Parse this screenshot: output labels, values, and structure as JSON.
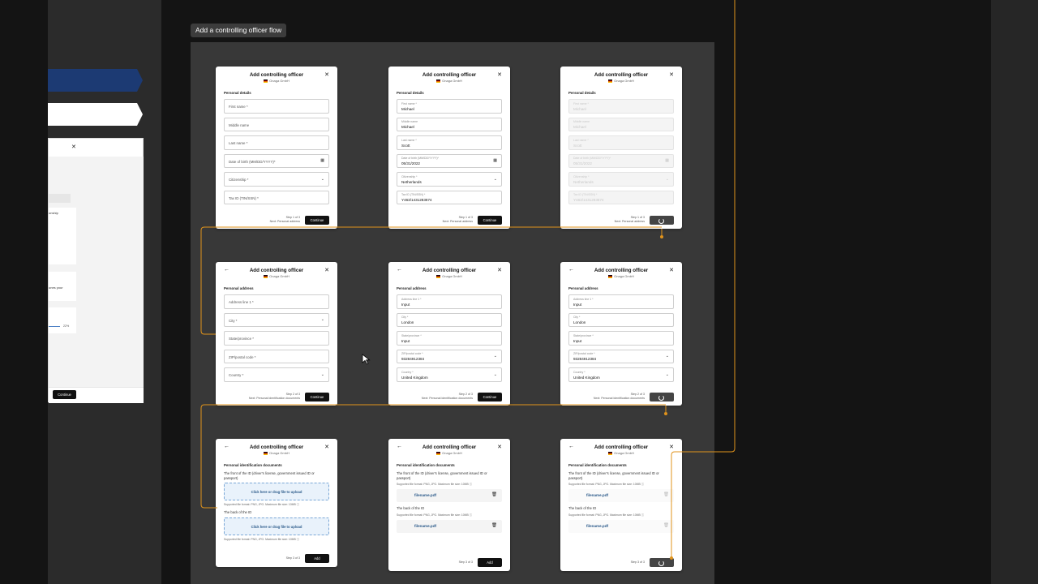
{
  "flow_title": "Add a controlling officer flow",
  "left_partial": {
    "continue_label": "Continue",
    "fragments": [
      "onship",
      "unes your",
      "22%"
    ]
  },
  "modals": {
    "title": "Add controlling officer",
    "company": "Onaga GmbH",
    "personal": {
      "section": "Personal details",
      "first_name": "First name *",
      "middle_name": "Middle name",
      "last_name": "Last name *",
      "dob": "Date of birth (MM/DD/YYYY)*",
      "citizenship": "Citizenship *",
      "tax_id": "Tax ID (TIN/SSN) *",
      "values": {
        "first_name": "Michael",
        "middle_name": "Michael",
        "last_name": "Scott",
        "dob": "05/31/2022",
        "citizenship": "Netherlands",
        "tax_id": "Y463/1431283874"
      },
      "step": "Step 1 of 3",
      "next": "Next: Personal address"
    },
    "address": {
      "section": "Personal address",
      "line1": "Address line 1 *",
      "city": "City *",
      "state": "State/province *",
      "zip": "ZIP/postal code *",
      "country": "Country *",
      "values": {
        "line1": "Input",
        "city": "London",
        "state": "Input",
        "zip": "93284912384",
        "country": "United Kingdom"
      },
      "step": "Step 2 of 3",
      "next": "Next: Personal identification documents"
    },
    "ident": {
      "section": "Personal identification documents",
      "front": "The front of the ID (driver's license, government issued ID or passport)",
      "back": "The back of the ID",
      "hint": "Supported file format: PNG, JPG. Maximum file size: 10MB",
      "drop": "Click here or drag file to upload",
      "filename": "filename.pdf",
      "step": "Step 3 of 3"
    },
    "continue_label": "Continue",
    "add_label": "Add"
  },
  "icons": {
    "close": "close-icon",
    "back": "arrow-left-icon",
    "calendar": "calendar-icon",
    "chevron": "chevron-down-icon",
    "trash": "trash-icon",
    "info": "info-icon",
    "cursor": "mouse-cursor-icon"
  },
  "colors": {
    "canvas": "#141414",
    "flow_bg": "#383838",
    "wire": "#e0931b",
    "button": "#111111",
    "drop_bg": "#e9f2fb",
    "link": "#2b5a8a",
    "nav_blue": "#1c3a73"
  }
}
